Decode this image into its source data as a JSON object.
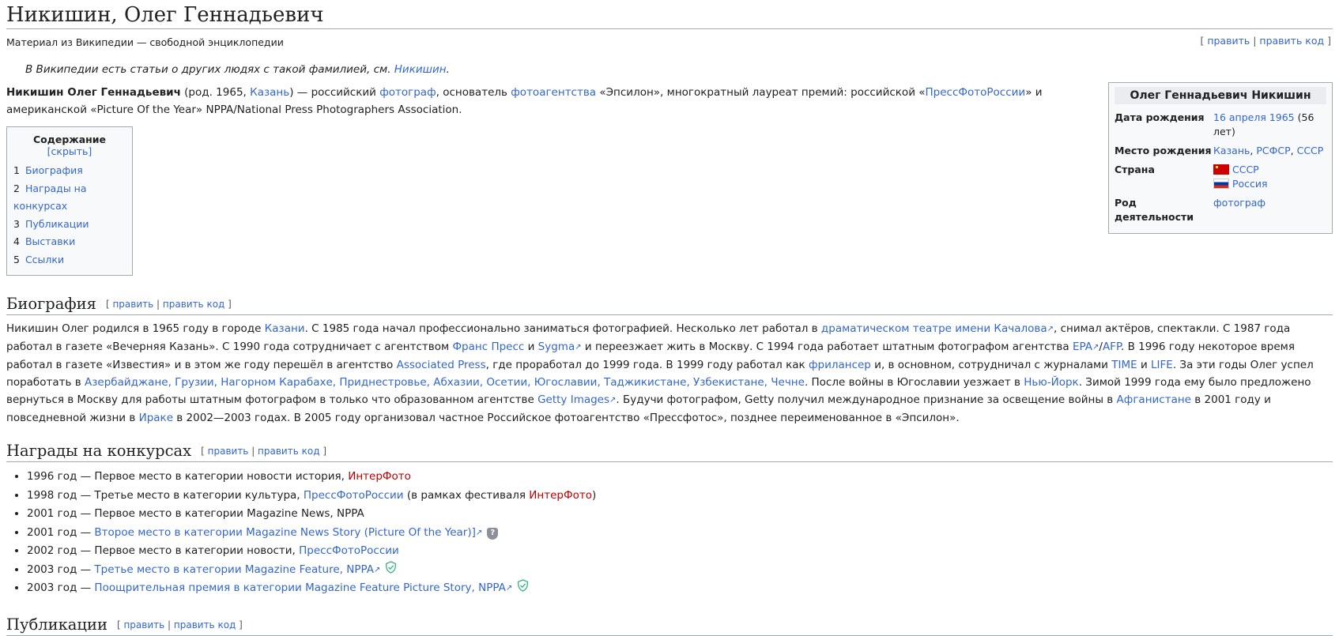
{
  "article": {
    "title": "Никишин, Олег Геннадьевич",
    "tagline": "Материал из Википедии — свободной энциклопедии",
    "top_edit": "[ ",
    "edit_label": "править",
    "sep": " | ",
    "edit_source_label": "править код",
    "close_br": " ]",
    "hatnote_prefix": "В Википедии есть статьи о других людях с такой фамилией, см. ",
    "hatnote_link": "Никишин",
    "hatnote_suffix": "."
  },
  "lead": {
    "name": "Никишин Олег Геннадьевич",
    "t1": " (род. 1965, ",
    "l_kazan": "Казань",
    "t2": ") — российский ",
    "l_photographer": "фотограф",
    "t3": ", основатель ",
    "l_agency": "фотоагентства",
    "t4": " «Эпсилон», многократный лауреат премий: российской «",
    "l_pressphoto": "ПрессФотоРоссии",
    "t5": "» и американской «Picture Of the Year» NPPA/National Press Photographers Association."
  },
  "infobox": {
    "title": "Олег Геннадьевич Никишин",
    "birth_date_label": "Дата рождения",
    "birth_date_link": "16 апреля 1965",
    "birth_date_age": " (56 лет)",
    "birth_place_label": "Место рождения",
    "birth_place_1": "Казань",
    "birth_place_2": "РСФСР",
    "birth_place_3": "СССР",
    "comma": ", ",
    "country_label": "Страна",
    "country_1": "СССР",
    "country_2": "Россия",
    "occupation_label": "Род деятельности",
    "occupation": "фотограф"
  },
  "toc": {
    "title": "Содержание",
    "toggle": "[скрыть]",
    "items": [
      {
        "num": "1",
        "label": "Биография"
      },
      {
        "num": "2",
        "label": "Награды на конкурсах"
      },
      {
        "num": "3",
        "label": "Публикации"
      },
      {
        "num": "4",
        "label": "Выставки"
      },
      {
        "num": "5",
        "label": "Ссылки"
      }
    ]
  },
  "sections": {
    "bio": "Биография",
    "awards": "Награды на конкурсах",
    "publications": "Публикации"
  },
  "bio": {
    "s1": "Никишин Олег родился в 1965 году в городе ",
    "l_kazan": "Казани",
    "s2": ". С 1985 года начал профессионально заниматься фотографией. Несколько лет работал в ",
    "l_theatre": "драматическом театре имени Качалова",
    "s3": ", снимал актёров, спектакли. С 1987 года работал в газете «Вечерняя Казань». С 1990 года сотрудничает с агентством ",
    "l_france": "Франс Пресс",
    "s4": " и ",
    "l_sygma": "Sygma",
    "s5": " и переезжает жить в Москву. С 1994 года работает штатным фотографом агентства ",
    "l_epa": "EPA",
    "s6": "/",
    "l_afp": "AFP",
    "s7": ". В 1996 году некоторое время работал в газете «Известия» и в этом же году перешёл в агентство ",
    "l_ap": "Associated Press",
    "s8": ", где проработал до 1999 года. В 1999 году работал как ",
    "l_freelancer": "фрилансер",
    "s9": " и, в основном, сотрудничал с журналами ",
    "l_time": "TIME",
    "s10": " и ",
    "l_life": "LIFE",
    "s11": ". За эти годы Олег успел поработать в ",
    "l_regions": "Азербайджане, Грузии, Нагорном Карабахе, Приднестровье, Абхазии, Осетии, Югославии, Таджикистане, Узбекистане, Чечне",
    "s12": ". После войны в Югославии уезжает в ",
    "l_ny": "Нью-Йорк",
    "s13": ". Зимой 1999 года ему было предложено вернуться в Москву для работы штатным фотографом в только что образованном агентстве ",
    "l_getty": "Getty Images",
    "s14": ". Будучи фотографом, Getty получил международное признание за освещение войны в ",
    "l_afgh": "Афганистане",
    "s15": " в 2001 году и повседневной жизни в ",
    "l_iraq": "Ираке",
    "s16": " в 2002—2003 годах. В 2005 году организовал частное Российское фотоагентство «Прессфотос», позднее переименованное в «Эпсилон»."
  },
  "awards": {
    "a1_text": "1996 год — Первое место в категории новости история, ",
    "a1_link": "ИнтерФото",
    "a2_text": "1998 год — Третье место в категории культура, ",
    "a2_link": "ПрессФотоРоссии",
    "a2_mid": " (в рамках фестиваля ",
    "a2_link2": "ИнтерФото",
    "a2_end": ")",
    "a3_text": "2001 год — Первое место в категории Magazine News, NPPA",
    "a4_text": "2001 год — ",
    "a4_link": "Второе место в категории Magazine News Story (Picture Of the Year)]",
    "a5_text": "2002 год — Первое место в категории новости, ",
    "a5_link": "ПрессФотоРоссии",
    "a6_text": "2003 год — ",
    "a6_link": "Третье место в категории Magazine Feature, NPPA",
    "a7_text": "2003 год — ",
    "a7_link": "Поощрительная премия в категории Magazine Feature Picture Story, NPPA"
  },
  "icons": {
    "external": "↗",
    "question": "?"
  }
}
